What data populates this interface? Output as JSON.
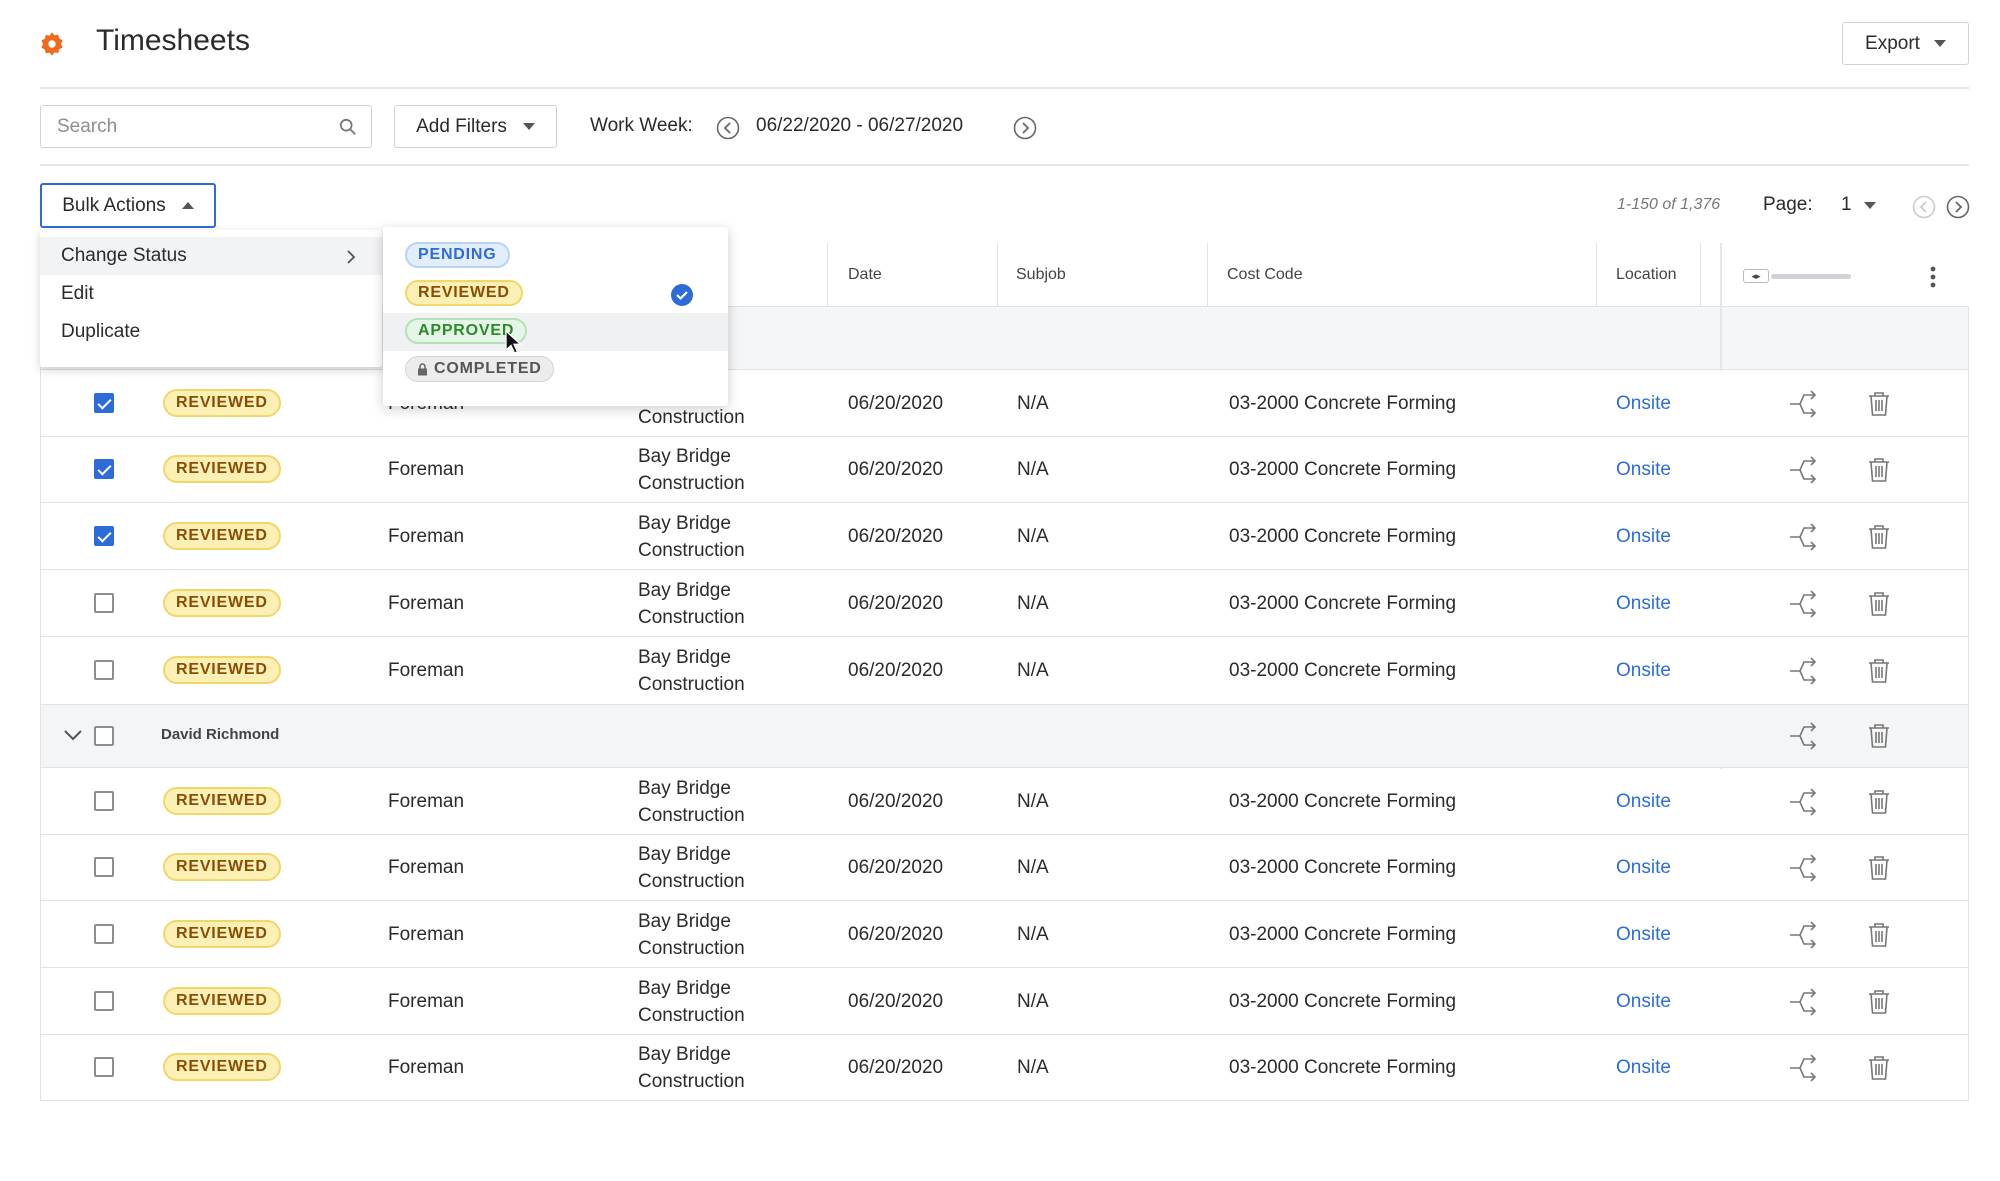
{
  "header": {
    "title": "Timesheets",
    "export_label": "Export"
  },
  "filters": {
    "search_placeholder": "Search",
    "add_filters_label": "Add Filters",
    "work_week_label": "Work Week:",
    "work_week_range": "06/22/2020 - 06/27/2020"
  },
  "bulk": {
    "bulk_actions_label": "Bulk Actions",
    "menu": [
      "Change Status",
      "Edit",
      "Duplicate"
    ],
    "status_options": [
      "PENDING",
      "REVIEWED",
      "APPROVED",
      "COMPLETED"
    ],
    "selected_status": "REVIEWED"
  },
  "pagination": {
    "count": "1-150 of 1,376",
    "page_label": "Page:",
    "page_value": "1"
  },
  "table": {
    "columns": [
      "Date",
      "Subjob",
      "Cost Code",
      "Location"
    ],
    "group_name": "David Richmond",
    "rows": [
      {
        "status": "REVIEWED",
        "role": "Foreman",
        "project": "Construction",
        "date": "06/20/2020",
        "subjob": "N/A",
        "cost_code": "03-2000 Concrete Forming",
        "location": "Onsite",
        "checked": true
      },
      {
        "status": "REVIEWED",
        "role": "Foreman",
        "project": "Bay Bridge Construction",
        "date": "06/20/2020",
        "subjob": "N/A",
        "cost_code": "03-2000 Concrete Forming",
        "location": "Onsite",
        "checked": true
      },
      {
        "status": "REVIEWED",
        "role": "Foreman",
        "project": "Bay Bridge Construction",
        "date": "06/20/2020",
        "subjob": "N/A",
        "cost_code": "03-2000 Concrete Forming",
        "location": "Onsite",
        "checked": true
      },
      {
        "status": "REVIEWED",
        "role": "Foreman",
        "project": "Bay Bridge Construction",
        "date": "06/20/2020",
        "subjob": "N/A",
        "cost_code": "03-2000 Concrete Forming",
        "location": "Onsite",
        "checked": false
      },
      {
        "status": "REVIEWED",
        "role": "Foreman",
        "project": "Bay Bridge Construction",
        "date": "06/20/2020",
        "subjob": "N/A",
        "cost_code": "03-2000 Concrete Forming",
        "location": "Onsite",
        "checked": false
      },
      {
        "status": "REVIEWED",
        "role": "Foreman",
        "project": "Bay Bridge Construction",
        "date": "06/20/2020",
        "subjob": "N/A",
        "cost_code": "03-2000 Concrete Forming",
        "location": "Onsite",
        "checked": false
      },
      {
        "status": "REVIEWED",
        "role": "Foreman",
        "project": "Bay Bridge Construction",
        "date": "06/20/2020",
        "subjob": "N/A",
        "cost_code": "03-2000 Concrete Forming",
        "location": "Onsite",
        "checked": false
      },
      {
        "status": "REVIEWED",
        "role": "Foreman",
        "project": "Bay Bridge Construction",
        "date": "06/20/2020",
        "subjob": "N/A",
        "cost_code": "03-2000 Concrete Forming",
        "location": "Onsite",
        "checked": false
      },
      {
        "status": "REVIEWED",
        "role": "Foreman",
        "project": "Bay Bridge Construction",
        "date": "06/20/2020",
        "subjob": "N/A",
        "cost_code": "03-2000 Concrete Forming",
        "location": "Onsite",
        "checked": false
      },
      {
        "status": "REVIEWED",
        "role": "Foreman",
        "project": "Bay Bridge Construction",
        "date": "06/20/2020",
        "subjob": "N/A",
        "cost_code": "03-2000 Concrete Forming",
        "location": "Onsite",
        "checked": false
      }
    ]
  },
  "colors": {
    "accent": "#2d6cd8",
    "logo": "#f06a1d",
    "reviewed_bg": "#fdf0b4",
    "reviewed_text": "#8a4d07"
  }
}
